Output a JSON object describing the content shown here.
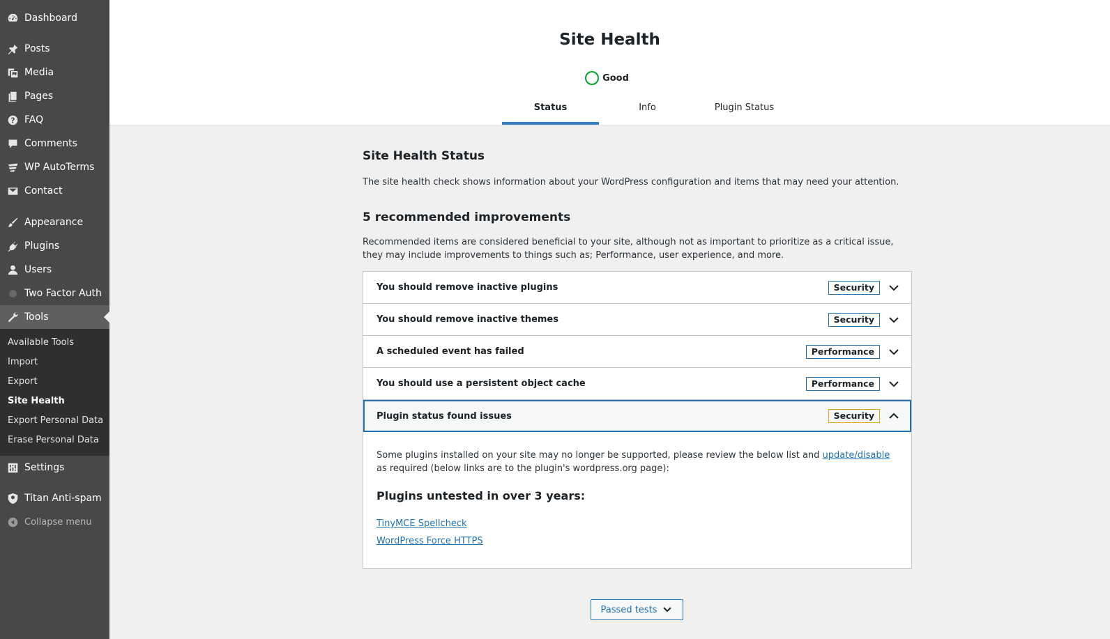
{
  "sidebar": {
    "items": [
      {
        "label": "Dashboard",
        "icon": "dashboard-icon"
      },
      {
        "label": "Posts",
        "icon": "pin-icon"
      },
      {
        "label": "Media",
        "icon": "media-icon"
      },
      {
        "label": "Pages",
        "icon": "pages-icon"
      },
      {
        "label": "FAQ",
        "icon": "help-icon"
      },
      {
        "label": "Comments",
        "icon": "comment-icon"
      },
      {
        "label": "WP AutoTerms",
        "icon": "autoterms-icon"
      },
      {
        "label": "Contact",
        "icon": "mail-icon"
      },
      {
        "label": "Appearance",
        "icon": "brush-icon"
      },
      {
        "label": "Plugins",
        "icon": "plugin-icon"
      },
      {
        "label": "Users",
        "icon": "user-icon"
      },
      {
        "label": "Two Factor Auth",
        "icon": "gear-icon"
      },
      {
        "label": "Tools",
        "icon": "wrench-icon"
      },
      {
        "label": "Settings",
        "icon": "settings-icon"
      },
      {
        "label": "Titan Anti-spam",
        "icon": "shield-icon"
      }
    ],
    "tools_submenu": [
      "Available Tools",
      "Import",
      "Export",
      "Site Health",
      "Export Personal Data",
      "Erase Personal Data"
    ],
    "collapse_label": "Collapse menu"
  },
  "header": {
    "title": "Site Health",
    "status": "Good",
    "tabs": [
      "Status",
      "Info",
      "Plugin Status"
    ]
  },
  "main": {
    "heading": "Site Health Status",
    "description": "The site health check shows information about your WordPress configuration and items that may need your attention.",
    "rec_heading": "5 recommended improvements",
    "rec_description": "Recommended items are considered beneficial to your site, although not as important to prioritize as a critical issue, they may include improvements to things such as; Performance, user experience, and more.",
    "items": [
      {
        "title": "You should remove inactive plugins",
        "badge": "Security"
      },
      {
        "title": "You should remove inactive themes",
        "badge": "Security"
      },
      {
        "title": "A scheduled event has failed",
        "badge": "Performance"
      },
      {
        "title": "You should use a persistent object cache",
        "badge": "Performance"
      },
      {
        "title": "Plugin status found issues",
        "badge": "Security"
      }
    ],
    "panel": {
      "text_before": "Some plugins installed on your site may no longer be supported, please review the below list and ",
      "link": "update/disable",
      "text_after": " as required (below links are to the plugin's wordpress.org page):",
      "subheading": "Plugins untested in over 3 years:",
      "plugins": [
        "TinyMCE Spellcheck",
        "WordPress Force HTTPS"
      ]
    },
    "passed_tests_label": "Passed tests"
  },
  "colors": {
    "accent": "#2271b1",
    "good": "#00a32a",
    "sidebar": "#484848",
    "warning": "#dba617"
  }
}
